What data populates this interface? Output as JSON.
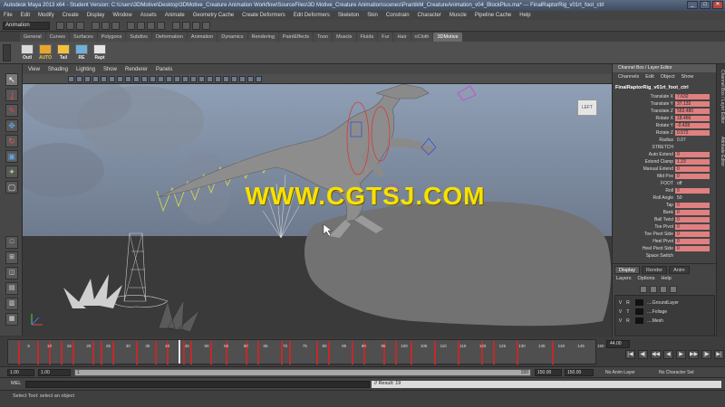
{
  "window": {
    "title": "Autodesk Maya 2013 x64 - Student Version: C:\\Users\\3DMotive\\Desktop\\3DMotive_Creature Animation Workflow\\SourceFiles\\3D Motive_Creature Animation\\scenes\\PrantikM_CreatureAnimation_v04_BlockPlus.ma* --- FinalRaptorRig_v01rt_foot_ctrl",
    "buttons": [
      "_",
      "□",
      "✕"
    ]
  },
  "menubar": [
    "Edit",
    "Modify",
    "Create",
    "Display",
    "Window",
    "Assets",
    "Animate",
    "Geometry Cache",
    "Create Deformers",
    "Edit Deformers",
    "Skeleton",
    "Skin",
    "Constrain",
    "Character",
    "Muscle",
    "Pipeline Cache",
    "Help"
  ],
  "menubar_first": "File",
  "status_line": {
    "mode": "Animation"
  },
  "shelf_tabs": [
    "General",
    "Curves",
    "Surfaces",
    "Polygons",
    "Subdivs",
    "Deformation",
    "Animation",
    "Dynamics",
    "Rendering",
    "PaintEffects",
    "Toon",
    "Muscle",
    "Fluids",
    "Fur",
    "Hair",
    "nCloth",
    "3DMotive"
  ],
  "shelf_active": "3DMotive",
  "shelf_buttons": [
    "Outl",
    "AUTO",
    "Tail",
    "RE",
    "Rapt"
  ],
  "panel_menu": [
    "View",
    "Shading",
    "Lighting",
    "Show",
    "Renderer",
    "Panels"
  ],
  "view_cube": "LEFT",
  "watermark": "WWW.CGTSJ.COM",
  "channel_box": {
    "header": "Channel Box / Layer Editor",
    "menu": [
      "Channels",
      "Edit",
      "Object",
      "Show"
    ],
    "object": "FinalRaptorRig_v01rt_foot_ctrl",
    "attributes": [
      {
        "name": "Translate X",
        "value": "7.632",
        "keyed": true
      },
      {
        "name": "Translate Y",
        "value": "37.132",
        "keyed": true
      },
      {
        "name": "Translate Z",
        "value": "563.480",
        "keyed": true
      },
      {
        "name": "Rotate X",
        "value": "18.466",
        "keyed": true
      },
      {
        "name": "Rotate Y",
        "value": "-0.428",
        "keyed": true
      },
      {
        "name": "Rotate Z",
        "value": "0.572",
        "keyed": true
      },
      {
        "name": "Radius",
        "value": "0.07",
        "keyed": false
      },
      {
        "name": "STRETCH",
        "value": "",
        "keyed": false
      },
      {
        "name": "Auto Extend",
        "value": "0",
        "keyed": true
      },
      {
        "name": "Extend Clamp",
        "value": "1.23",
        "keyed": true
      },
      {
        "name": "Manual Extend",
        "value": "0",
        "keyed": true
      },
      {
        "name": "Mid Pos",
        "value": "0",
        "keyed": true
      },
      {
        "name": "FOOT",
        "value": "off",
        "keyed": false
      },
      {
        "name": "Roll",
        "value": "0",
        "keyed": true
      },
      {
        "name": "Roll Angle",
        "value": "50",
        "keyed": false
      },
      {
        "name": "Tap",
        "value": "0",
        "keyed": true
      },
      {
        "name": "Bank",
        "value": "0",
        "keyed": true
      },
      {
        "name": "Ball Twist",
        "value": "0",
        "keyed": true
      },
      {
        "name": "Toe Pivot",
        "value": "0",
        "keyed": true
      },
      {
        "name": "Toe Pivot Side",
        "value": "0",
        "keyed": true
      },
      {
        "name": "Heel Pivot",
        "value": "0",
        "keyed": true
      },
      {
        "name": "Heel Pivot Side",
        "value": "0",
        "keyed": true
      },
      {
        "name": "Space Switch",
        "value": "",
        "keyed": false
      }
    ]
  },
  "layer_editor": {
    "tabs": [
      "Display",
      "Render",
      "Anim"
    ],
    "active_tab": "Display",
    "menu": [
      "Layers",
      "Options",
      "Help"
    ],
    "layers": [
      {
        "v": "V",
        "t": "R",
        "name": "....GroundLayer"
      },
      {
        "v": "V",
        "t": "T",
        "name": "....Foliage"
      },
      {
        "v": "V",
        "t": "R",
        "name": "....Mesh"
      }
    ]
  },
  "side_tabs": [
    "Channel Box / Layer Editor",
    "Attribute Editor"
  ],
  "timeline": {
    "ticks": [
      "5",
      "10",
      "15",
      "20",
      "25",
      "30",
      "35",
      "40",
      "45",
      "50",
      "55",
      "60",
      "65",
      "70",
      "75",
      "80",
      "85",
      "90",
      "95",
      "100",
      "105",
      "110",
      "115",
      "120",
      "125",
      "130",
      "135",
      "140",
      "145",
      "150"
    ],
    "key_frames": [
      3,
      8,
      11,
      14,
      17,
      22,
      24,
      27,
      33,
      38,
      41,
      45,
      47,
      52,
      56,
      61,
      64,
      70,
      72,
      79,
      82,
      88,
      91,
      96,
      99,
      103,
      109,
      115,
      121,
      124,
      130,
      139
    ],
    "current_frame": "44.00",
    "start": 1,
    "end": 150
  },
  "playback": [
    "|◀",
    "◀|",
    "◀◀",
    "◀",
    "▶",
    "▶▶",
    "|▶",
    "▶|"
  ],
  "range": {
    "start_time": "1.00",
    "range_start": "1.00",
    "slider_lo": "1",
    "slider_hi": "150",
    "range_end": "150.00",
    "end_time": "150.00",
    "anim_layer": "No Anim Layer",
    "character_set": "No Character Set"
  },
  "command_line": {
    "label": "MEL",
    "result": "// Result: 19"
  },
  "help_line": "Select Tool: select an object"
}
